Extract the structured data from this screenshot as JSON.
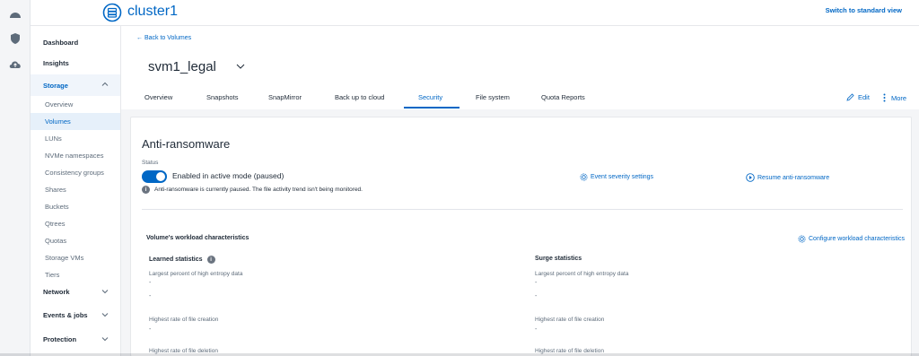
{
  "topbar": {
    "cluster_name": "cluster1",
    "switch_view": "Switch to standard view"
  },
  "rail": {
    "icons": [
      "dashboard-gauge-icon",
      "shield-icon",
      "cloud-upload-icon"
    ]
  },
  "nav": {
    "items": [
      {
        "label": "Dashboard"
      },
      {
        "label": "Insights"
      },
      {
        "label": "Storage"
      },
      {
        "label": "Overview"
      },
      {
        "label": "Volumes"
      },
      {
        "label": "LUNs"
      },
      {
        "label": "NVMe namespaces"
      },
      {
        "label": "Consistency groups"
      },
      {
        "label": "Shares"
      },
      {
        "label": "Buckets"
      },
      {
        "label": "Qtrees"
      },
      {
        "label": "Quotas"
      },
      {
        "label": "Storage VMs"
      },
      {
        "label": "Tiers"
      },
      {
        "label": "Network"
      },
      {
        "label": "Events & jobs"
      },
      {
        "label": "Protection"
      }
    ]
  },
  "header": {
    "back_link": "← Back to Volumes",
    "volume_name": "svm1_legal",
    "tabs": [
      {
        "label": "Overview"
      },
      {
        "label": "Snapshots"
      },
      {
        "label": "SnapMirror"
      },
      {
        "label": "Back up to cloud"
      },
      {
        "label": "Security"
      },
      {
        "label": "File system"
      },
      {
        "label": "Quota Reports"
      }
    ],
    "edit_label": "Edit",
    "more_label": "More"
  },
  "anti_ransomware": {
    "title": "Anti-ransomware",
    "status_label": "Status",
    "toggle_text": "Enabled in active mode (paused)",
    "info_text": "Anti-ransomware is currently paused. The file activity trend isn't being monitored.",
    "event_severity_link": "Event severity settings",
    "resume_link": "Resume anti-ransomware"
  },
  "workload": {
    "title": "Volume's workload characteristics",
    "configure_link": "Configure workload characteristics",
    "learned": {
      "heading": "Learned statistics",
      "entropy_label": "Largest percent of high entropy data",
      "entropy_value_1": "-",
      "entropy_value_2": "-",
      "creation_label": "Highest rate of file creation",
      "creation_value": "-",
      "deletion_label": "Highest rate of file deletion"
    },
    "surge": {
      "heading": "Surge statistics",
      "entropy_label": "Largest percent of high entropy data",
      "entropy_value_1": "-",
      "entropy_value_2": "-",
      "creation_label": "Highest rate of file creation",
      "creation_value": "-",
      "deletion_label": "Highest rate of file deletion"
    }
  },
  "colors": {
    "accent": "#0067c5",
    "text": "#1f2a37",
    "muted": "#5d6b7a",
    "background": "#f4f5f7"
  }
}
